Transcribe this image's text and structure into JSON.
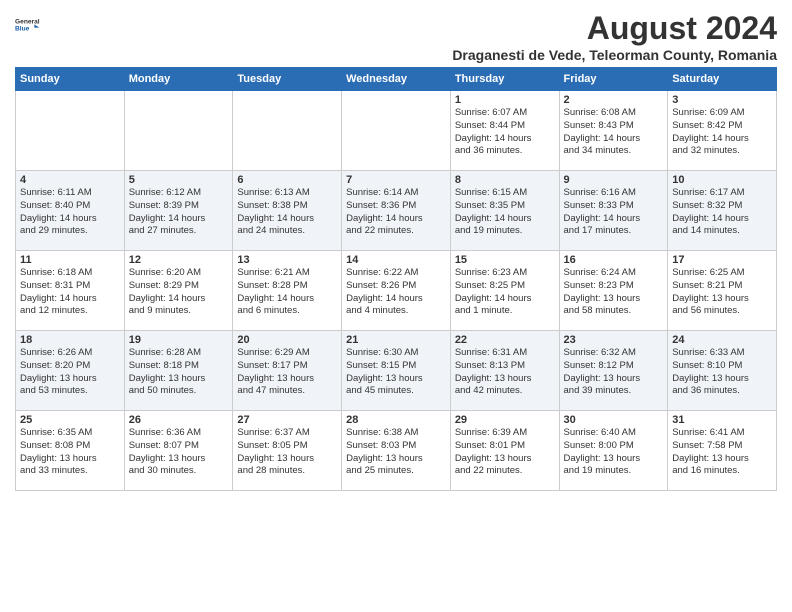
{
  "logo": {
    "line1": "General",
    "line2": "Blue"
  },
  "title": "August 2024",
  "subtitle": "Draganesti de Vede, Teleorman County, Romania",
  "days_of_week": [
    "Sunday",
    "Monday",
    "Tuesday",
    "Wednesday",
    "Thursday",
    "Friday",
    "Saturday"
  ],
  "weeks": [
    [
      {
        "day": "",
        "info": ""
      },
      {
        "day": "",
        "info": ""
      },
      {
        "day": "",
        "info": ""
      },
      {
        "day": "",
        "info": ""
      },
      {
        "day": "1",
        "info": "Sunrise: 6:07 AM\nSunset: 8:44 PM\nDaylight: 14 hours\nand 36 minutes."
      },
      {
        "day": "2",
        "info": "Sunrise: 6:08 AM\nSunset: 8:43 PM\nDaylight: 14 hours\nand 34 minutes."
      },
      {
        "day": "3",
        "info": "Sunrise: 6:09 AM\nSunset: 8:42 PM\nDaylight: 14 hours\nand 32 minutes."
      }
    ],
    [
      {
        "day": "4",
        "info": "Sunrise: 6:11 AM\nSunset: 8:40 PM\nDaylight: 14 hours\nand 29 minutes."
      },
      {
        "day": "5",
        "info": "Sunrise: 6:12 AM\nSunset: 8:39 PM\nDaylight: 14 hours\nand 27 minutes."
      },
      {
        "day": "6",
        "info": "Sunrise: 6:13 AM\nSunset: 8:38 PM\nDaylight: 14 hours\nand 24 minutes."
      },
      {
        "day": "7",
        "info": "Sunrise: 6:14 AM\nSunset: 8:36 PM\nDaylight: 14 hours\nand 22 minutes."
      },
      {
        "day": "8",
        "info": "Sunrise: 6:15 AM\nSunset: 8:35 PM\nDaylight: 14 hours\nand 19 minutes."
      },
      {
        "day": "9",
        "info": "Sunrise: 6:16 AM\nSunset: 8:33 PM\nDaylight: 14 hours\nand 17 minutes."
      },
      {
        "day": "10",
        "info": "Sunrise: 6:17 AM\nSunset: 8:32 PM\nDaylight: 14 hours\nand 14 minutes."
      }
    ],
    [
      {
        "day": "11",
        "info": "Sunrise: 6:18 AM\nSunset: 8:31 PM\nDaylight: 14 hours\nand 12 minutes."
      },
      {
        "day": "12",
        "info": "Sunrise: 6:20 AM\nSunset: 8:29 PM\nDaylight: 14 hours\nand 9 minutes."
      },
      {
        "day": "13",
        "info": "Sunrise: 6:21 AM\nSunset: 8:28 PM\nDaylight: 14 hours\nand 6 minutes."
      },
      {
        "day": "14",
        "info": "Sunrise: 6:22 AM\nSunset: 8:26 PM\nDaylight: 14 hours\nand 4 minutes."
      },
      {
        "day": "15",
        "info": "Sunrise: 6:23 AM\nSunset: 8:25 PM\nDaylight: 14 hours\nand 1 minute."
      },
      {
        "day": "16",
        "info": "Sunrise: 6:24 AM\nSunset: 8:23 PM\nDaylight: 13 hours\nand 58 minutes."
      },
      {
        "day": "17",
        "info": "Sunrise: 6:25 AM\nSunset: 8:21 PM\nDaylight: 13 hours\nand 56 minutes."
      }
    ],
    [
      {
        "day": "18",
        "info": "Sunrise: 6:26 AM\nSunset: 8:20 PM\nDaylight: 13 hours\nand 53 minutes."
      },
      {
        "day": "19",
        "info": "Sunrise: 6:28 AM\nSunset: 8:18 PM\nDaylight: 13 hours\nand 50 minutes."
      },
      {
        "day": "20",
        "info": "Sunrise: 6:29 AM\nSunset: 8:17 PM\nDaylight: 13 hours\nand 47 minutes."
      },
      {
        "day": "21",
        "info": "Sunrise: 6:30 AM\nSunset: 8:15 PM\nDaylight: 13 hours\nand 45 minutes."
      },
      {
        "day": "22",
        "info": "Sunrise: 6:31 AM\nSunset: 8:13 PM\nDaylight: 13 hours\nand 42 minutes."
      },
      {
        "day": "23",
        "info": "Sunrise: 6:32 AM\nSunset: 8:12 PM\nDaylight: 13 hours\nand 39 minutes."
      },
      {
        "day": "24",
        "info": "Sunrise: 6:33 AM\nSunset: 8:10 PM\nDaylight: 13 hours\nand 36 minutes."
      }
    ],
    [
      {
        "day": "25",
        "info": "Sunrise: 6:35 AM\nSunset: 8:08 PM\nDaylight: 13 hours\nand 33 minutes."
      },
      {
        "day": "26",
        "info": "Sunrise: 6:36 AM\nSunset: 8:07 PM\nDaylight: 13 hours\nand 30 minutes."
      },
      {
        "day": "27",
        "info": "Sunrise: 6:37 AM\nSunset: 8:05 PM\nDaylight: 13 hours\nand 28 minutes."
      },
      {
        "day": "28",
        "info": "Sunrise: 6:38 AM\nSunset: 8:03 PM\nDaylight: 13 hours\nand 25 minutes."
      },
      {
        "day": "29",
        "info": "Sunrise: 6:39 AM\nSunset: 8:01 PM\nDaylight: 13 hours\nand 22 minutes."
      },
      {
        "day": "30",
        "info": "Sunrise: 6:40 AM\nSunset: 8:00 PM\nDaylight: 13 hours\nand 19 minutes."
      },
      {
        "day": "31",
        "info": "Sunrise: 6:41 AM\nSunset: 7:58 PM\nDaylight: 13 hours\nand 16 minutes."
      }
    ]
  ]
}
